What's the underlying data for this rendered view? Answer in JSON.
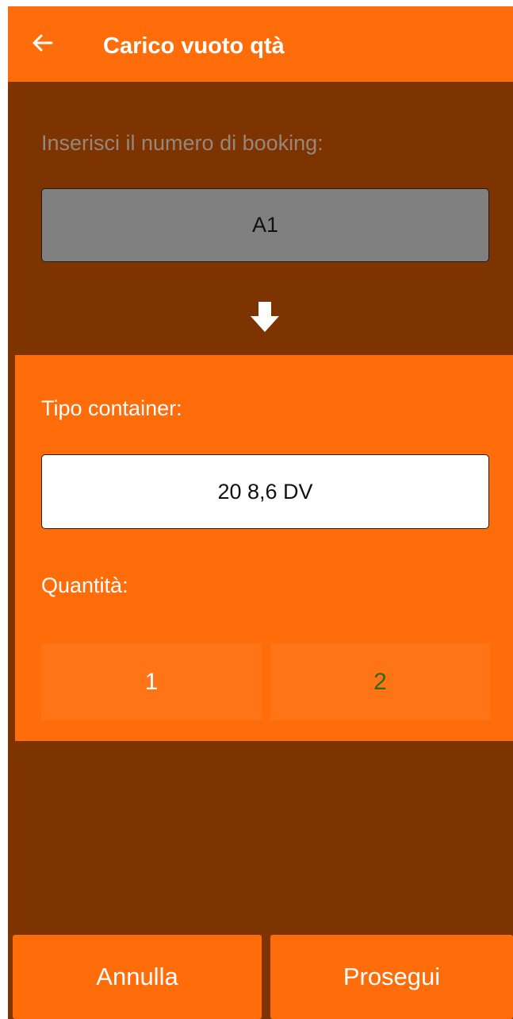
{
  "header": {
    "title": "Carico vuoto qtà",
    "back_icon": "arrow-left-icon"
  },
  "booking": {
    "label": "Inserisci il numero di booking:",
    "value": "A1"
  },
  "flow_icon": "down-arrow-icon",
  "container": {
    "type_label": "Tipo container:",
    "type_value": "20 8,6 DV",
    "quantity_label": "Quantità:",
    "quantity_options": [
      "1",
      "2"
    ],
    "selected_quantity": "2"
  },
  "actions": {
    "cancel_label": "Annulla",
    "continue_label": "Prosegui"
  },
  "colors": {
    "accent": "#ff6c0a",
    "background": "#7e3400",
    "booking_field": "#808080",
    "selected_quantity_text": "#2e6b0e"
  }
}
